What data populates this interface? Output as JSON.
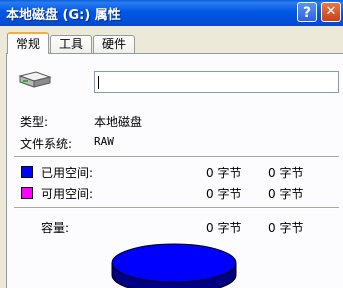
{
  "window": {
    "title": "本地磁盘 (G:) 属性",
    "help_label": "?",
    "close_label": "✕"
  },
  "tabs": [
    {
      "label": "常规",
      "active": true
    },
    {
      "label": "工具",
      "active": false
    },
    {
      "label": "硬件",
      "active": false
    }
  ],
  "general": {
    "volume_label_value": "",
    "type_label": "类型:",
    "type_value": "本地磁盘",
    "fs_label": "文件系统:",
    "fs_value": "RAW",
    "used": {
      "label": "已用空间:",
      "bytes": "0 字节",
      "size": "0 字节",
      "color": "#0000ff"
    },
    "free": {
      "label": "可用空间:",
      "bytes": "0 字节",
      "size": "0 字节",
      "color": "#ff00ff"
    },
    "capacity": {
      "label": "容量:",
      "bytes": "0 字节",
      "size": "0 字节"
    }
  },
  "icons": {
    "drive": "hard-drive-icon",
    "pie": "disk-usage-pie-chart"
  },
  "colors": {
    "titlebar": "#0058e6",
    "pie_fill": "#0000ff",
    "pie_side": "#000080"
  }
}
